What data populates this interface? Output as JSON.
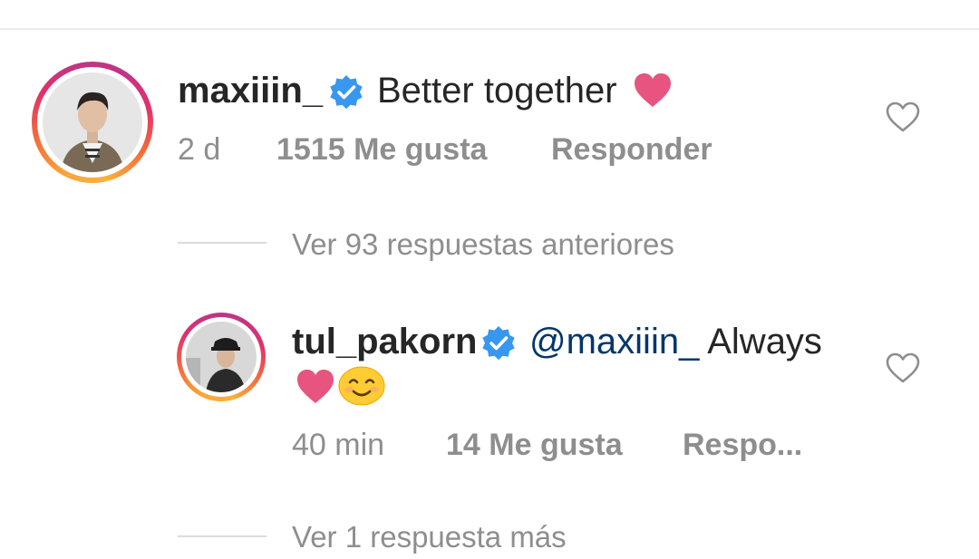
{
  "comment": {
    "username": "maxiiin_",
    "text": "Better together",
    "age": "2 d",
    "likes": "1515 Me gusta",
    "reply_label": "Responder"
  },
  "view_previous_replies": "Ver 93 respuestas anteriores",
  "reply": {
    "username": "tul_pakorn",
    "mention": "@maxiiin_",
    "text": "Always",
    "age": "40 min",
    "likes": "14 Me gusta",
    "reply_label": "Respo..."
  },
  "view_more_replies": "Ver 1 respuesta más",
  "colors": {
    "verified_blue": "#3897f0",
    "emoji_heart": "#e75480",
    "mention": "#00376b",
    "muted_text": "#8e8e8e"
  },
  "icons": {
    "verified": "verified-badge-icon",
    "like": "heart-outline-icon",
    "emoji_heart": "pink-heart-emoji",
    "emoji_smile": "smiling-face-emoji"
  }
}
